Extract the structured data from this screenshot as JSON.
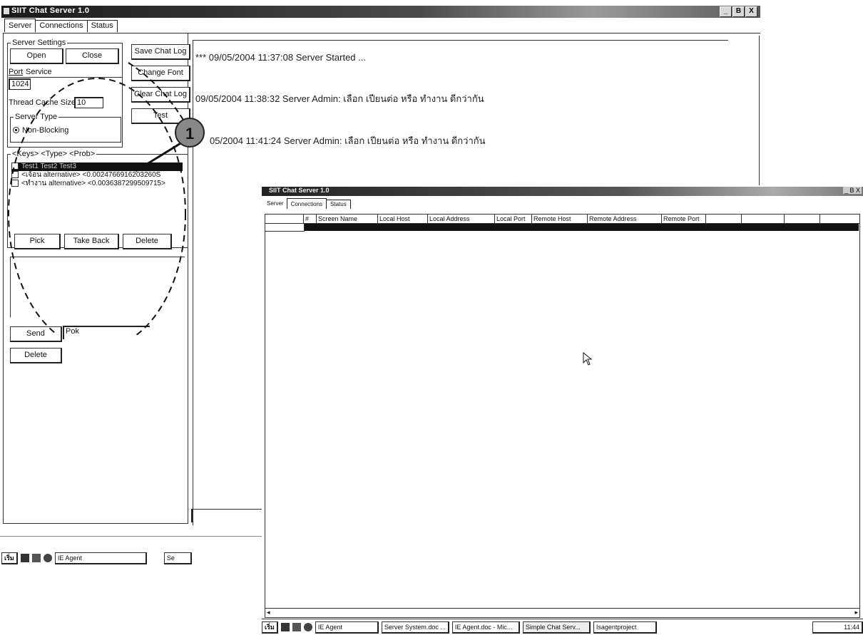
{
  "main_window": {
    "title": "SIIT Chat Server 1.0",
    "controls": [
      "_",
      "B",
      "X"
    ],
    "tabs": [
      "Server",
      "Connections",
      "Status"
    ],
    "server_settings": {
      "legend": "Server Settings",
      "open_label": "Open",
      "close_label": "Close",
      "port_label": "Port",
      "service_label": "Service",
      "port_value": "1024",
      "thread_cache_label": "Thread Cache Size",
      "thread_cache_value": "10",
      "server_type_legend": "Server Type",
      "server_type_option": "Non-Blocking"
    },
    "side_buttons": [
      "Save Chat Log",
      "Change Font",
      "Clear Chat Log",
      "Test"
    ],
    "callout_number": "1",
    "keys_panel": {
      "header": "<Keys> <Type> <Prob>",
      "rows": [
        "Test1 Test2 Test3",
        "<เจ้อน alternative> <0.0024766916203260S",
        "<ทำงาน alternative> <0.0036387299509715>"
      ],
      "pick_label": "Pick",
      "take_back_label": "Take Back",
      "delete_label": "Delete"
    },
    "send_label": "Send",
    "send_input_value": "Pok",
    "delete2_label": "Delete",
    "chat_log": [
      "*** 09/05/2004 11:37:08 Server Started ...",
      "09/05/2004 11:38:32 Server Admin: เลือก เปียนต่อ หรือ ทำงาน ดีกว่ากัน",
      "05/2004 11:41:24 Server Admin: เลือก เปียนต่อ หรือ ทำงาน ดีกว่ากัน"
    ],
    "taskbar": [
      "เริ่ม",
      "IE Agent",
      "Se"
    ]
  },
  "second_window": {
    "title": "SIIT Chat Server 1.0",
    "tabs": [
      "Server",
      "Connections",
      "Status"
    ],
    "columns": [
      "#",
      "Screen Name",
      "Local Host",
      "Local Address",
      "Local Port",
      "Remote Host",
      "Remote Address",
      "Remote Port"
    ],
    "taskbar": [
      "เริ่ม",
      "IE Agent",
      "Server System.doc ...",
      "IE Agent.doc - Mic...",
      "Simple Chat Serv...",
      "Isagentproject",
      "11:44"
    ]
  }
}
